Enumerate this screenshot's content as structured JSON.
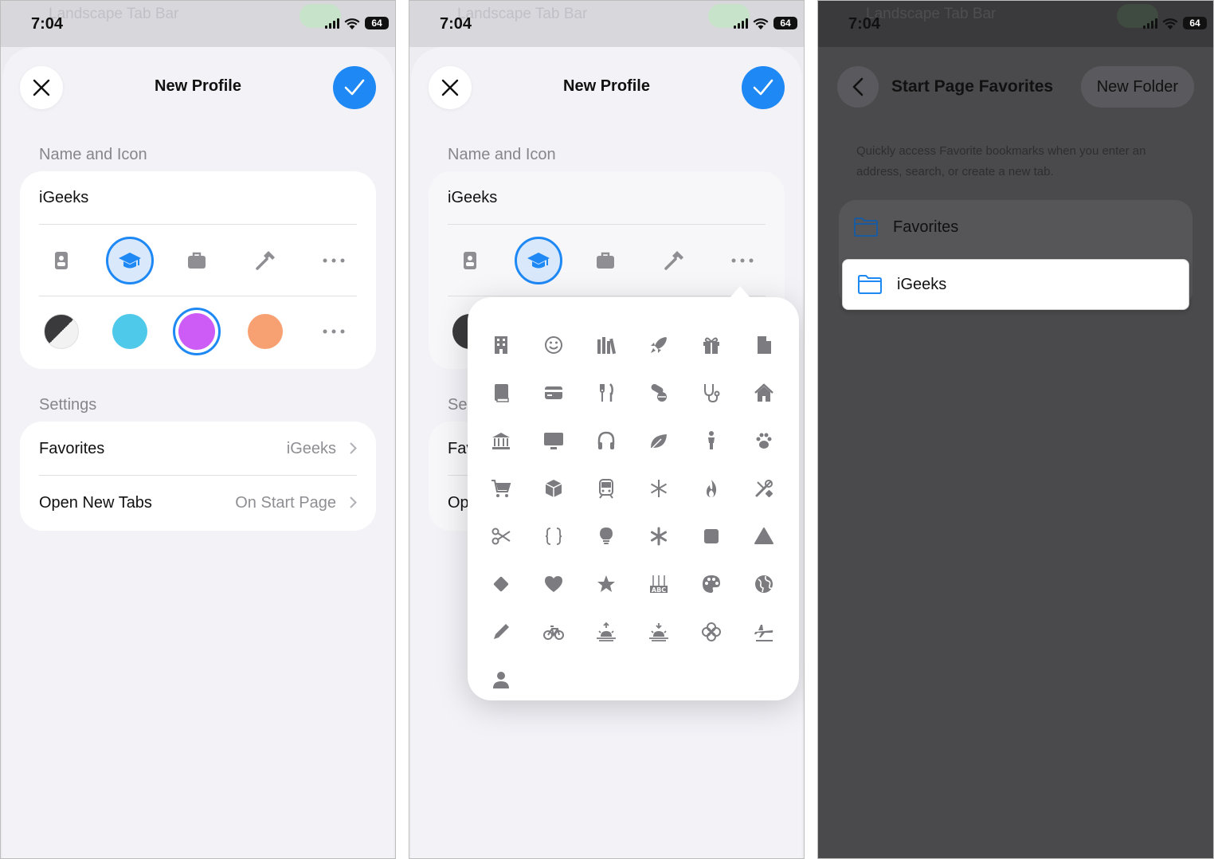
{
  "status": {
    "time": "7:04",
    "battery": "64",
    "ghost_text": "Landscape Tab Bar"
  },
  "panel1": {
    "title": "New Profile",
    "section_name": "Name and Icon",
    "profile_name": "iGeeks",
    "icon_row": [
      "id-badge-icon",
      "graduation-cap-icon",
      "briefcase-icon",
      "hammer-icon",
      "more-icon"
    ],
    "selected_icon": "graduation-cap-icon",
    "colors": [
      "#3a3a3c",
      "#4ec9ea",
      "#cc5cf5",
      "#f7a072"
    ],
    "selected_color": "#cc5cf5",
    "section_settings": "Settings",
    "settings": [
      {
        "label": "Favorites",
        "value": "iGeeks"
      },
      {
        "label": "Open New Tabs",
        "value": "On Start Page"
      }
    ]
  },
  "panel2": {
    "title": "New Profile",
    "section_name": "Name and Icon",
    "profile_name": "iGeeks",
    "section_settings_partial": "Se",
    "row1_partial": "Fav",
    "row2_partial": "Op",
    "icon_grid": [
      "building-icon",
      "smiley-icon",
      "books-icon",
      "rocket-icon",
      "gift-icon",
      "document-icon",
      "book-icon",
      "credit-card-icon",
      "fork-knife-icon",
      "pills-icon",
      "stethoscope-icon",
      "house-icon",
      "bank-icon",
      "tv-icon",
      "headphones-icon",
      "leaf-icon",
      "person-standing-icon",
      "paw-icon",
      "cart-icon",
      "box-icon",
      "tram-icon",
      "snowflake-icon",
      "flame-icon",
      "tools-icon",
      "scissors-icon",
      "braces-icon",
      "lightbulb-icon",
      "asterisk-icon",
      "square-icon",
      "triangle-icon",
      "diamond-icon",
      "heart-icon",
      "star-icon",
      "abc-blocks-icon",
      "palette-icon",
      "globe-icon",
      "pencil-icon",
      "bicycle-icon",
      "sunrise-icon",
      "sunset-icon",
      "flower-icon",
      "airplane-icon",
      "person-icon"
    ]
  },
  "panel3": {
    "title": "Start Page Favorites",
    "new_folder": "New Folder",
    "description": "Quickly access Favorite bookmarks when you enter an address, search, or create a new tab.",
    "folders": [
      "Favorites",
      "iGeeks"
    ],
    "highlighted_folder": "iGeeks"
  }
}
